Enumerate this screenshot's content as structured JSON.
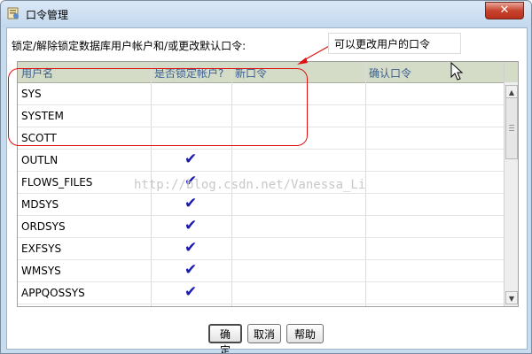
{
  "window": {
    "title": "口令管理",
    "close_glyph": "✕"
  },
  "prompt": "锁定/解除锁定数据库用户帐户和/或更改默认口令:",
  "grid": {
    "columns": [
      "用户名",
      "是否锁定帐户?",
      "新口令",
      "确认口令"
    ],
    "rows": [
      {
        "user": "SYS",
        "locked": false
      },
      {
        "user": "SYSTEM",
        "locked": false
      },
      {
        "user": "SCOTT",
        "locked": false
      },
      {
        "user": "OUTLN",
        "locked": true
      },
      {
        "user": "FLOWS_FILES",
        "locked": true
      },
      {
        "user": "MDSYS",
        "locked": true
      },
      {
        "user": "ORDSYS",
        "locked": true
      },
      {
        "user": "EXFSYS",
        "locked": true
      },
      {
        "user": "WMSYS",
        "locked": true
      },
      {
        "user": "APPQOSSYS",
        "locked": true
      }
    ],
    "check_glyph": "✔"
  },
  "annotation": {
    "text": "可以更改用户的口令",
    "color": "#e01010"
  },
  "watermark": "http://blog.csdn.net/Vanessa_Li",
  "buttons": {
    "ok": "确定",
    "cancel": "取消",
    "help": "帮助"
  },
  "icons": {
    "title": "dialog-icon",
    "close": "close-icon",
    "scroll_up": "arrow-up-icon",
    "scroll_down": "arrow-down-icon",
    "cursor": "mouse-pointer-icon"
  }
}
